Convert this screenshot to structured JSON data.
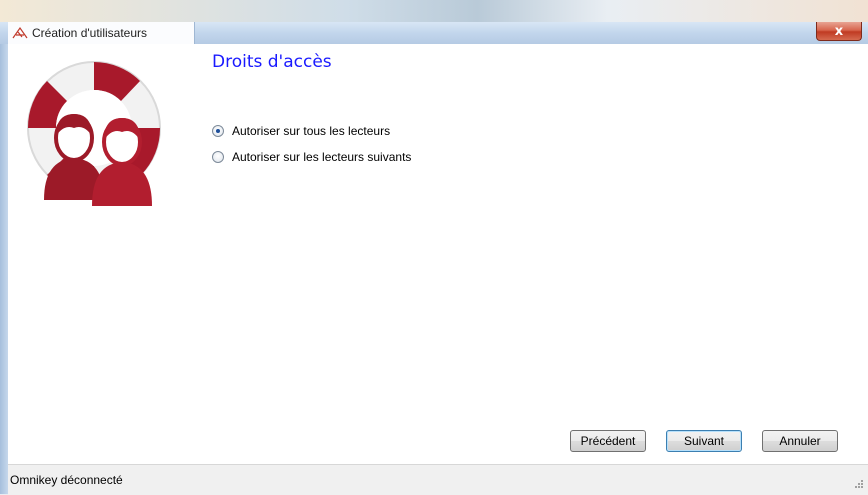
{
  "window": {
    "title": "Création d'utilisateurs",
    "close_label": "x"
  },
  "page": {
    "title": "Droits d'accès"
  },
  "access_options": [
    {
      "label": "Autoriser sur tous les lecteurs",
      "checked": true
    },
    {
      "label": "Autoriser sur les lecteurs suivants",
      "checked": false
    }
  ],
  "buttons": {
    "previous": "Précédent",
    "next": "Suivant",
    "cancel": "Annuler"
  },
  "status": {
    "text": "Omnikey déconnecté"
  },
  "colors": {
    "title_blue": "#1a1aff",
    "logo_red": "#a8192b"
  },
  "icons": {
    "app": "app-icon",
    "logo": "users-lifebuoy-icon",
    "close": "close-icon"
  }
}
